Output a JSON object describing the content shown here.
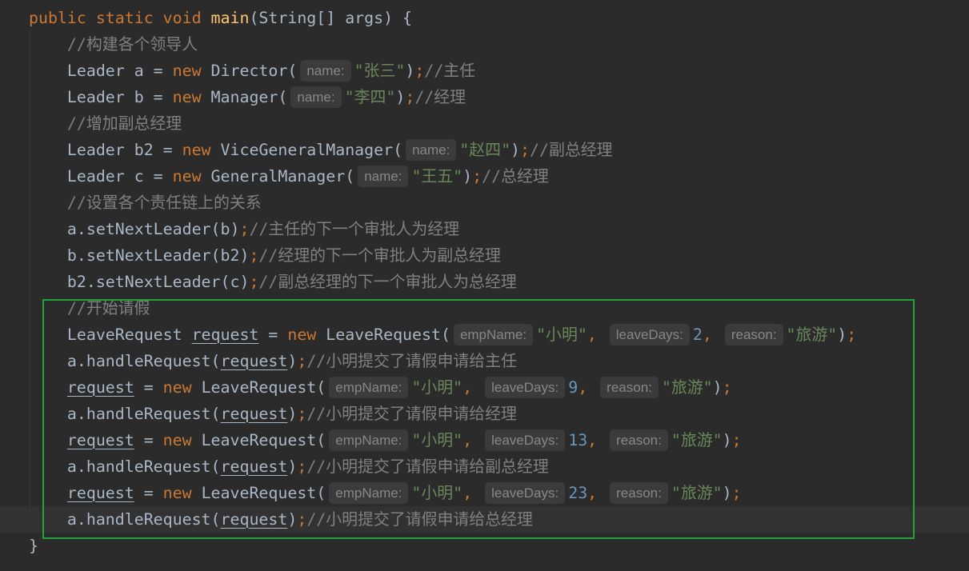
{
  "theme": {
    "background": "#2b2b2b",
    "caret_row": "#323232",
    "text": "#a9b7c6",
    "keyword": "#cc7832",
    "method": "#ffc66d",
    "string": "#6a8759",
    "number": "#6897bb",
    "comment": "#808080",
    "hint_text": "#878787",
    "hint_background": "#3b3b3b",
    "annotation_box": "#24a340",
    "indent_guide": "#383838"
  },
  "editor": {
    "lines": [
      {
        "tokens": [
          {
            "kw": "public static void "
          },
          {
            "fn": "main"
          },
          {
            "txt": "(String[] args) {"
          }
        ]
      },
      {
        "tokens": [
          {
            "cmt": "    //构建各个领导人"
          }
        ]
      },
      {
        "tokens": [
          {
            "txt": "    Leader a = "
          },
          {
            "kw": "new"
          },
          {
            "txt": " Director("
          },
          {
            "hint": "name:"
          },
          {
            "str": "\"张三\""
          },
          {
            "txt": ")"
          },
          {
            "op": ";"
          },
          {
            "cmt": "//主任"
          }
        ]
      },
      {
        "tokens": [
          {
            "txt": "    Leader b = "
          },
          {
            "kw": "new"
          },
          {
            "txt": " Manager("
          },
          {
            "hint": "name:"
          },
          {
            "str": "\"李四\""
          },
          {
            "txt": ")"
          },
          {
            "op": ";"
          },
          {
            "cmt": "//经理"
          }
        ]
      },
      {
        "tokens": [
          {
            "cmt": "    //增加副总经理"
          }
        ]
      },
      {
        "tokens": [
          {
            "txt": "    Leader b2 = "
          },
          {
            "kw": "new"
          },
          {
            "txt": " ViceGeneralManager("
          },
          {
            "hint": "name:"
          },
          {
            "str": "\"赵四\""
          },
          {
            "txt": ")"
          },
          {
            "op": ";"
          },
          {
            "cmt": "//副总经理"
          }
        ]
      },
      {
        "tokens": [
          {
            "txt": "    Leader c = "
          },
          {
            "kw": "new"
          },
          {
            "txt": " GeneralManager("
          },
          {
            "hint": "name:"
          },
          {
            "str": "\"王五\""
          },
          {
            "txt": ")"
          },
          {
            "op": ";"
          },
          {
            "cmt": "//总经理"
          }
        ]
      },
      {
        "tokens": [
          {
            "cmt": "    //设置各个责任链上的关系"
          }
        ]
      },
      {
        "tokens": [
          {
            "txt": "    a.setNextLeader(b)"
          },
          {
            "op": ";"
          },
          {
            "cmt": "//主任的下一个审批人为经理"
          }
        ]
      },
      {
        "tokens": [
          {
            "txt": "    b.setNextLeader(b2)"
          },
          {
            "op": ";"
          },
          {
            "cmt": "//经理的下一个审批人为副总经理"
          }
        ]
      },
      {
        "tokens": [
          {
            "txt": "    b2.setNextLeader(c)"
          },
          {
            "op": ";"
          },
          {
            "cmt": "//副总经理的下一个审批人为总经理"
          }
        ]
      },
      {
        "tokens": [
          {
            "cmt": "    //开始请假"
          }
        ]
      },
      {
        "tokens": [
          {
            "txt": "    LeaveRequest "
          },
          {
            "var": "request"
          },
          {
            "txt": " = "
          },
          {
            "kw": "new"
          },
          {
            "txt": " LeaveRequest("
          },
          {
            "hint": "empName:"
          },
          {
            "str": "\"小明\""
          },
          {
            "op": ","
          },
          {
            "txt": " "
          },
          {
            "hint": "leaveDays:"
          },
          {
            "num": "2"
          },
          {
            "op": ","
          },
          {
            "txt": " "
          },
          {
            "hint": "reason:"
          },
          {
            "str": "\"旅游\""
          },
          {
            "txt": ")"
          },
          {
            "op": ";"
          }
        ]
      },
      {
        "tokens": [
          {
            "txt": "    a.handleRequest("
          },
          {
            "var": "request"
          },
          {
            "txt": ")"
          },
          {
            "op": ";"
          },
          {
            "cmt": "//小明提交了请假申请给主任"
          }
        ]
      },
      {
        "tokens": [
          {
            "txt": "    "
          },
          {
            "var": "request"
          },
          {
            "txt": " = "
          },
          {
            "kw": "new"
          },
          {
            "txt": " LeaveRequest("
          },
          {
            "hint": "empName:"
          },
          {
            "str": "\"小明\""
          },
          {
            "op": ","
          },
          {
            "txt": " "
          },
          {
            "hint": "leaveDays:"
          },
          {
            "num": "9"
          },
          {
            "op": ","
          },
          {
            "txt": " "
          },
          {
            "hint": "reason:"
          },
          {
            "str": "\"旅游\""
          },
          {
            "txt": ")"
          },
          {
            "op": ";"
          }
        ]
      },
      {
        "tokens": [
          {
            "txt": "    a.handleRequest("
          },
          {
            "var": "request"
          },
          {
            "txt": ")"
          },
          {
            "op": ";"
          },
          {
            "cmt": "//小明提交了请假申请给经理"
          }
        ]
      },
      {
        "tokens": [
          {
            "txt": "    "
          },
          {
            "var": "request"
          },
          {
            "txt": " = "
          },
          {
            "kw": "new"
          },
          {
            "txt": " LeaveRequest("
          },
          {
            "hint": "empName:"
          },
          {
            "str": "\"小明\""
          },
          {
            "op": ","
          },
          {
            "txt": " "
          },
          {
            "hint": "leaveDays:"
          },
          {
            "num": "13"
          },
          {
            "op": ","
          },
          {
            "txt": " "
          },
          {
            "hint": "reason:"
          },
          {
            "str": "\"旅游\""
          },
          {
            "txt": ")"
          },
          {
            "op": ";"
          }
        ]
      },
      {
        "tokens": [
          {
            "txt": "    a.handleRequest("
          },
          {
            "var": "request"
          },
          {
            "txt": ")"
          },
          {
            "op": ";"
          },
          {
            "cmt": "//小明提交了请假申请给副总经理"
          }
        ]
      },
      {
        "tokens": [
          {
            "txt": "    "
          },
          {
            "var": "request"
          },
          {
            "txt": " = "
          },
          {
            "kw": "new"
          },
          {
            "txt": " LeaveRequest("
          },
          {
            "hint": "empName:"
          },
          {
            "str": "\"小明\""
          },
          {
            "op": ","
          },
          {
            "txt": " "
          },
          {
            "hint": "leaveDays:"
          },
          {
            "num": "23"
          },
          {
            "op": ","
          },
          {
            "txt": " "
          },
          {
            "hint": "reason:"
          },
          {
            "str": "\"旅游\""
          },
          {
            "txt": ")"
          },
          {
            "op": ";"
          }
        ]
      },
      {
        "current": true,
        "tokens": [
          {
            "txt": "    a.handleRequest("
          },
          {
            "var": "request"
          },
          {
            "txt": ")"
          },
          {
            "op": ";"
          },
          {
            "cmt": "//小明提交了请假申请给总经理"
          }
        ]
      },
      {
        "tokens": [
          {
            "txt": "}"
          }
        ]
      }
    ]
  }
}
